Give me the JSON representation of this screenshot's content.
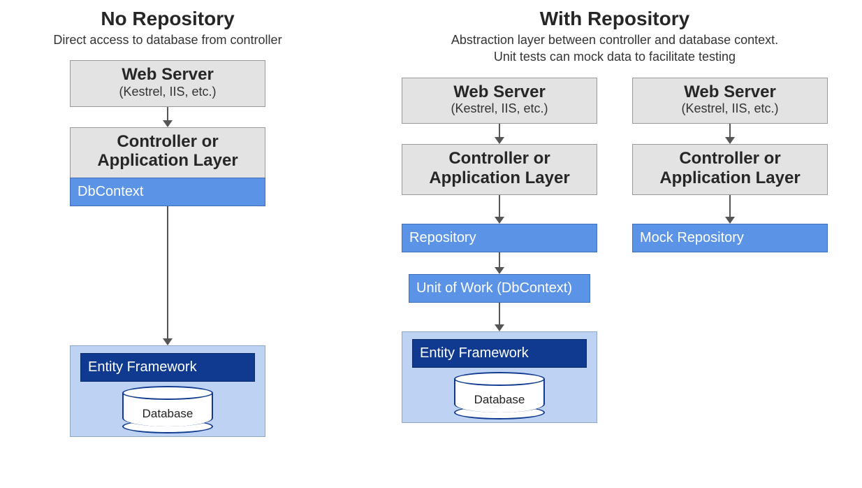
{
  "left": {
    "title": "No Repository",
    "subtitle": "Direct access to database from controller",
    "webserver_title": "Web Server",
    "webserver_sub": "(Kestrel, IIS, etc.)",
    "controller_line1": "Controller or",
    "controller_line2": "Application Layer",
    "dbcontext": "DbContext",
    "ef": "Entity Framework",
    "database": "Database"
  },
  "right": {
    "title": "With Repository",
    "subtitle_line1": "Abstraction layer between controller and database context.",
    "subtitle_line2": "Unit tests can mock data to facilitate testing",
    "flowA": {
      "webserver_title": "Web Server",
      "webserver_sub": "(Kestrel, IIS, etc.)",
      "controller_line1": "Controller or",
      "controller_line2": "Application Layer",
      "repository": "Repository",
      "uow": "Unit of Work (DbContext)",
      "ef": "Entity Framework",
      "database": "Database"
    },
    "flowB": {
      "webserver_title": "Web Server",
      "webserver_sub": "(Kestrel, IIS, etc.)",
      "controller_line1": "Controller or",
      "controller_line2": "Application Layer",
      "mock_repo": "Mock Repository"
    }
  },
  "colors": {
    "gray_box": "#e3e3e3",
    "blue_box": "#5b93e6",
    "darkblue_box": "#103a8f",
    "lightblue_bg": "#bed3f4",
    "arrow": "#555"
  }
}
